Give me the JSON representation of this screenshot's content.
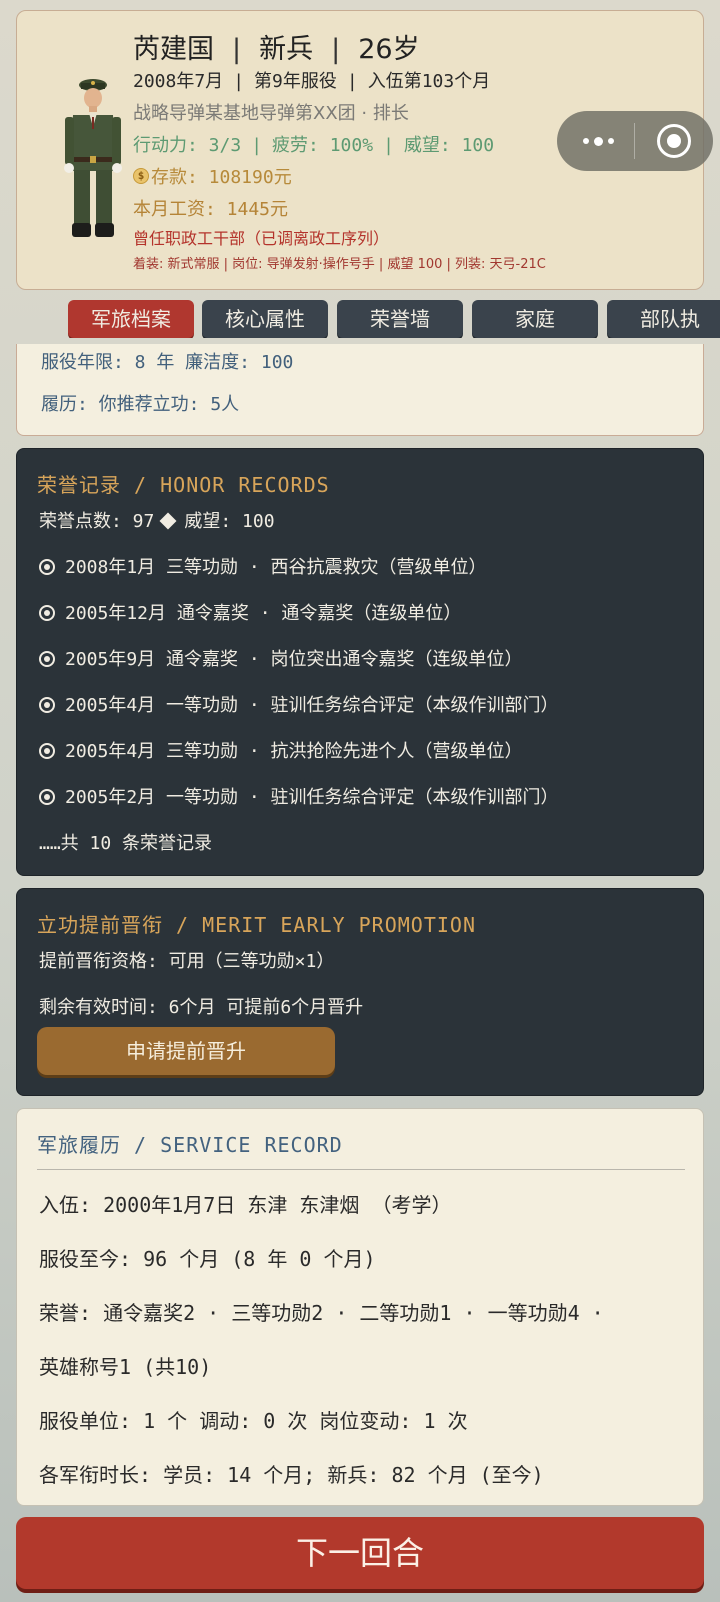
{
  "profile": {
    "name": "芮建国",
    "rank": "新兵",
    "age": "26岁",
    "date": "2008年7月",
    "service_year": "第9年服役",
    "months": "入伍第103个月",
    "unit": "战略导弹某基地导弹第XX团 · 排长",
    "stats": {
      "action": "行动力: 3/3",
      "fatigue": "疲劳: 100%",
      "prestige": "威望: 100"
    },
    "savings": "存款: 108190元",
    "wage": "本月工资: 1445元",
    "former": "曾任职政工干部（已调离政工序列）",
    "equipment": "着装: 新式常服 | 岗位: 导弹发射·操作号手 | 威望 100 | 列装: 天弓-21C",
    "avatar_icon": "soldier-avatar-icon"
  },
  "tabs": [
    "军旅档案",
    "核心属性",
    "荣誉墙",
    "家庭",
    "部队执"
  ],
  "archive": {
    "years": "服役年限: 8 年   廉洁度: 100",
    "record": "履历: 你推荐立功: 5人"
  },
  "honor": {
    "title": "荣誉记录 / HONOR RECORDS",
    "points": "荣誉点数: 97",
    "prestige": "威望: 100",
    "records": [
      "2008年1月 三等功勋 · 西谷抗震救灾（营级单位）",
      "2005年12月 通令嘉奖 · 通令嘉奖（连级单位）",
      "2005年9月 通令嘉奖 · 岗位突出通令嘉奖（连级单位）",
      "2005年4月 一等功勋 · 驻训任务综合评定（本级作训部门）",
      "2005年4月 三等功勋 · 抗洪抢险先进个人（营级单位）",
      "2005年2月 一等功勋 · 驻训任务综合评定（本级作训部门）"
    ],
    "total": "……共 10 条荣誉记录"
  },
  "merit": {
    "title": "立功提前晋衔 / MERIT EARLY PROMOTION",
    "eligibility": "提前晋衔资格: 可用（三等功勋×1）",
    "remaining": "剩余有效时间: 6个月   可提前6个月晋升",
    "button": "申请提前晋升"
  },
  "service": {
    "title": "军旅履历 / SERVICE RECORD",
    "lines": [
      "入伍: 2000年1月7日   东津 东津烟   （考学）",
      "服役至今: 96 个月 (8 年 0 个月)",
      "荣誉: 通令嘉奖2 · 三等功勋2 · 二等功勋1 · 一等功勋4 ·",
      "英雄称号1 (共10)",
      "服役单位: 1 个   调动: 0 次   岗位变动: 1 次",
      "各军衔时长: 学员: 14 个月; 新兵: 82 个月 (至今)"
    ]
  },
  "next_button": "下一回合",
  "colors": {
    "accent_red": "#b0372f",
    "panel_dark": "#2b3339",
    "gold": "#d8a55a",
    "stats_green": "#5d9a72"
  }
}
